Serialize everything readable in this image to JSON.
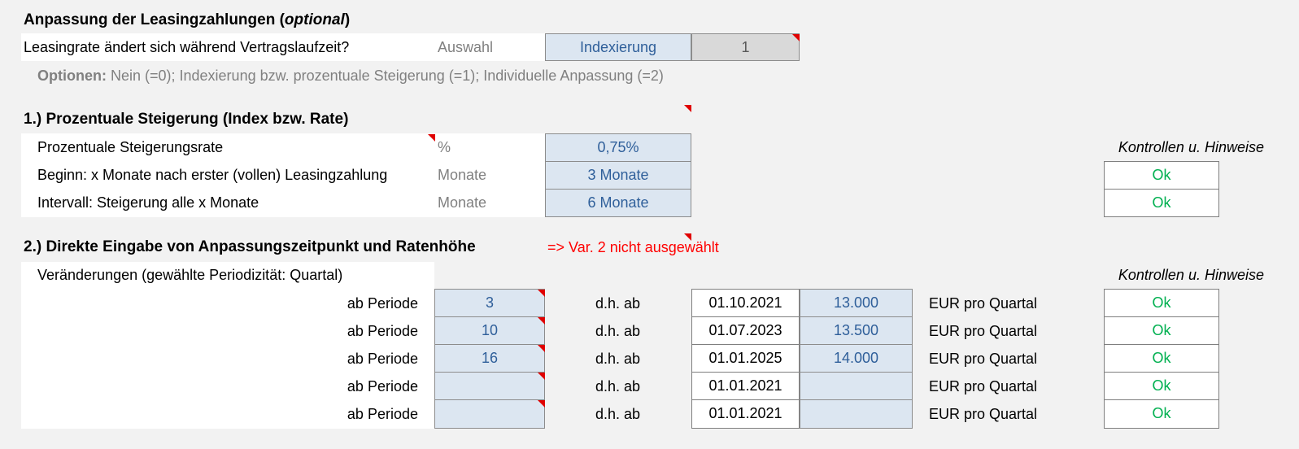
{
  "section_main": {
    "title_prefix": "Anpassung der Leasingzahlungen (",
    "title_em": "optional",
    "title_suffix": ")",
    "question": "Leasingrate ändert sich während Vertragslaufzeit?",
    "select_label": "Auswahl",
    "selection_text": "Indexierung",
    "selection_code": "1",
    "options_label": "Optionen:",
    "options_text": " Nein (=0); Indexierung bzw. prozentuale Steigerung (=1); Individuelle Anpassung (=2)"
  },
  "section1": {
    "title": "1.) Prozentuale Steigerung (Index bzw. Rate)",
    "hint_header": "Kontrollen u. Hinweise",
    "rows": [
      {
        "label": "Prozentuale Steigerungsrate",
        "unit": "%",
        "value": "0,75%",
        "check": ""
      },
      {
        "label": "Beginn: x Monate nach erster (vollen) Leasingzahlung",
        "unit": "Monate",
        "value": "3 Monate",
        "check": "Ok"
      },
      {
        "label": "Intervall: Steigerung alle x Monate",
        "unit": "Monate",
        "value": "6 Monate",
        "check": "Ok"
      }
    ]
  },
  "section2": {
    "title": "2.) Direkte Eingabe von Anpassungszeitpunkt und Ratenhöhe",
    "warning": "=> Var. 2 nicht ausgewählt",
    "subheader": "Veränderungen (gewählte Periodizität: Quartal)",
    "hint_header": "Kontrollen u. Hinweise",
    "rows": [
      {
        "label": "ab Periode",
        "period": "3",
        "dh": "d.h. ab",
        "date": "01.10.2021",
        "amount": "13.000",
        "unit": "EUR pro Quartal",
        "check": "Ok"
      },
      {
        "label": "ab Periode",
        "period": "10",
        "dh": "d.h. ab",
        "date": "01.07.2023",
        "amount": "13.500",
        "unit": "EUR pro Quartal",
        "check": "Ok"
      },
      {
        "label": "ab Periode",
        "period": "16",
        "dh": "d.h. ab",
        "date": "01.01.2025",
        "amount": "14.000",
        "unit": "EUR pro Quartal",
        "check": "Ok"
      },
      {
        "label": "ab Periode",
        "period": "",
        "dh": "d.h. ab",
        "date": "01.01.2021",
        "amount": "",
        "unit": "EUR pro Quartal",
        "check": "Ok"
      },
      {
        "label": "ab Periode",
        "period": "",
        "dh": "d.h. ab",
        "date": "01.01.2021",
        "amount": "",
        "unit": "EUR pro Quartal",
        "check": "Ok"
      }
    ]
  },
  "colors": {
    "input_fill": "#dce6f1",
    "input_text": "#2f5f9a",
    "ok_green": "#00b050",
    "warning_red": "#ff0000",
    "comment_marker": "#e00000"
  }
}
